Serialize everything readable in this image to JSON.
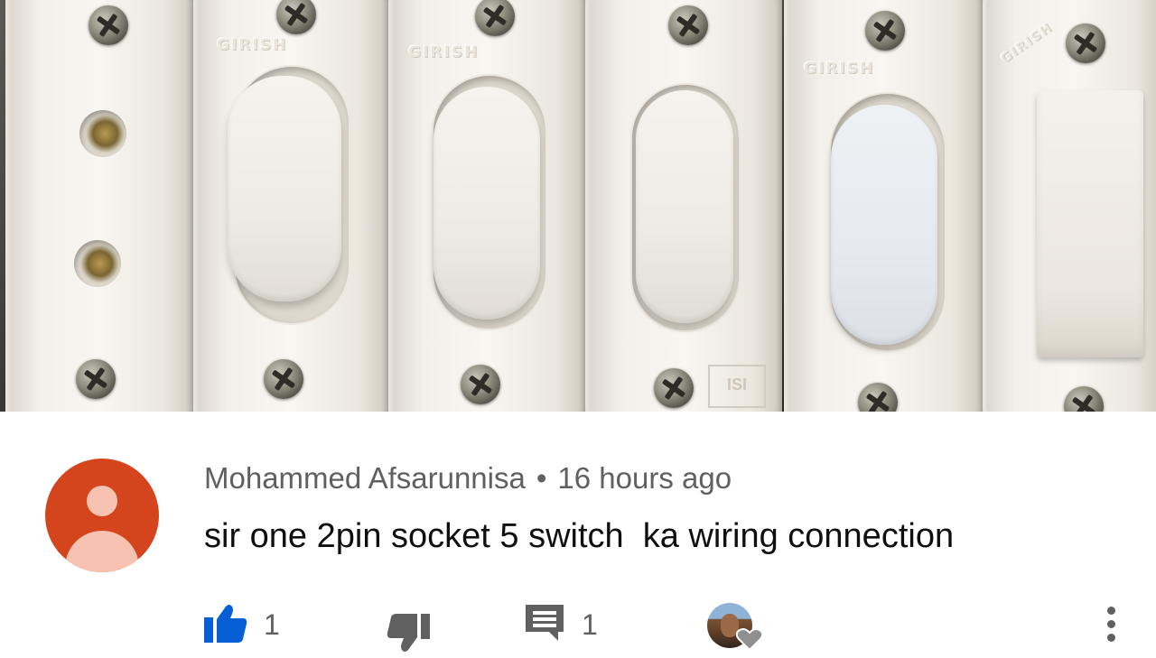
{
  "photo": {
    "brand_labels": [
      "GIRISH",
      "GIRISH",
      "GIRISH",
      "GIRISH"
    ],
    "isi_mark": "ISI"
  },
  "comment": {
    "author": "Mohammed Afsarunnisa",
    "separator": "•",
    "timestamp": "16 hours ago",
    "text": "sir one 2pin socket 5 switch  ka wiring connection",
    "avatar_color": "#d5451d",
    "avatar_icon": "person-icon"
  },
  "actions": {
    "like_count": "1",
    "reply_count": "1",
    "like_icon": "thumbs-up-icon",
    "dislike_icon": "thumbs-down-icon",
    "reply_icon": "comment-icon",
    "more_icon": "more-vertical-icon",
    "accent_color": "#065fd4"
  }
}
